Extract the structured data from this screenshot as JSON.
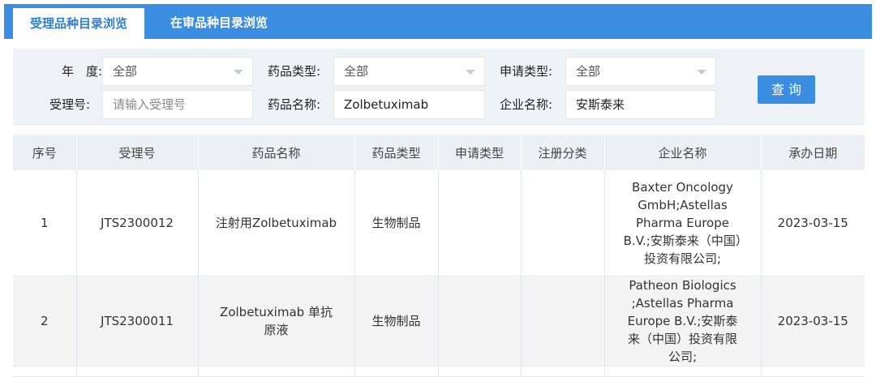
{
  "tabs": [
    {
      "label": "受理品种目录浏览",
      "active": true
    },
    {
      "label": "在审品种目录浏览",
      "active": false
    }
  ],
  "search": {
    "year": {
      "label": "年　度:",
      "value": "全部"
    },
    "drug_type": {
      "label": "药品类型:",
      "value": "全部"
    },
    "apply_type": {
      "label": "申请类型:",
      "value": "全部"
    },
    "accept_no": {
      "label": "受理号:",
      "placeholder": "请输入受理号"
    },
    "drug_name": {
      "label": "药品名称:",
      "value": "Zolbetuximab"
    },
    "company": {
      "label": "企业名称:",
      "value": "安斯泰来"
    },
    "query_button": "查 询"
  },
  "table": {
    "headers": [
      "序号",
      "受理号",
      "药品名称",
      "药品类型",
      "申请类型",
      "注册分类",
      "企业名称",
      "承办日期"
    ],
    "rows": [
      {
        "no": "1",
        "accept_no": "JTS2300012",
        "drug_name": "注射用Zolbetuximab",
        "drug_type": "生物制品",
        "apply_type": "",
        "reg_class": "",
        "company": "Baxter Oncology GmbH;Astellas Pharma Europe B.V.;安斯泰来（中国）投资有限公司;",
        "date": "2023-03-15"
      },
      {
        "no": "2",
        "accept_no": "JTS2300011",
        "drug_name": "Zolbetuximab 单抗原液",
        "drug_type": "生物制品",
        "apply_type": "",
        "reg_class": "",
        "company": "Patheon Biologics ;Astellas Pharma Europe B.V.;安斯泰来（中国）投资有限公司;",
        "date": "2023-03-15"
      }
    ]
  },
  "colors": {
    "accent": "#3a8de0",
    "header_bg": "#eceff3",
    "panel_bg": "#eef1f6"
  }
}
